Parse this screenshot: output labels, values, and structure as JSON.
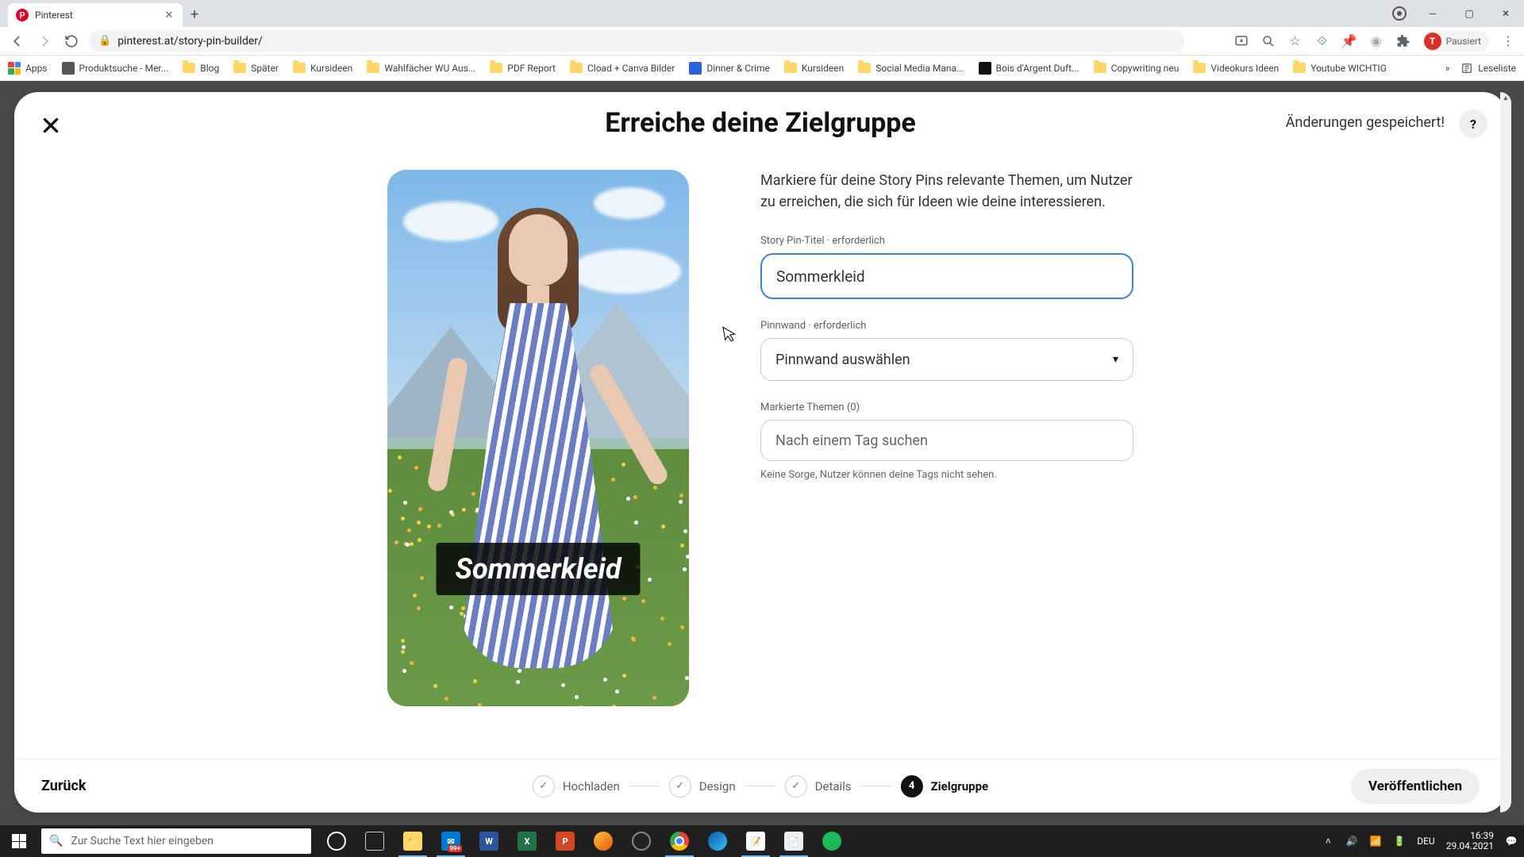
{
  "browser": {
    "tab_title": "Pinterest",
    "url": "pinterest.at/story-pin-builder/",
    "profile_state": "Pausiert",
    "profile_initial": "T"
  },
  "bookmarks": {
    "apps": "Apps",
    "items": [
      {
        "label": "Produktsuche - Mer...",
        "type": "page",
        "color": "#555"
      },
      {
        "label": "Blog",
        "type": "folder"
      },
      {
        "label": "Später",
        "type": "folder"
      },
      {
        "label": "Kursideen",
        "type": "folder"
      },
      {
        "label": "Wahlfächer WU Aus...",
        "type": "folder"
      },
      {
        "label": "PDF Report",
        "type": "folder"
      },
      {
        "label": "Cload + Canva Bilder",
        "type": "folder"
      },
      {
        "label": "Dinner & Crime",
        "type": "page",
        "color": "#2962d9"
      },
      {
        "label": "Kursideen",
        "type": "folder"
      },
      {
        "label": "Social Media Mana...",
        "type": "folder"
      },
      {
        "label": "Bois d'Argent Duft...",
        "type": "page",
        "color": "#111"
      },
      {
        "label": "Copywriting neu",
        "type": "folder"
      },
      {
        "label": "Videokurs Ideen",
        "type": "folder"
      },
      {
        "label": "Youtube WICHTIG",
        "type": "folder"
      }
    ],
    "reading_list": "Leseliste"
  },
  "modal": {
    "title": "Erreiche deine Zielgruppe",
    "saved": "Änderungen gespeichert!",
    "help": "?",
    "helper": "Markiere für deine Story Pins relevante Themen, um Nutzer zu erreichen, die sich für Ideen wie deine interessieren.",
    "preview_overlay": "Sommerkleid",
    "fields": {
      "title_label": "Story Pin-Titel · erforderlich",
      "title_value": "Sommerkleid",
      "board_label": "Pinnwand · erforderlich",
      "board_placeholder": "Pinnwand auswählen",
      "tags_label": "Markierte Themen (0)",
      "tags_placeholder": "Nach einem Tag suchen",
      "tags_hint": "Keine Sorge, Nutzer können deine Tags nicht sehen."
    }
  },
  "footer": {
    "back": "Zurück",
    "steps": [
      {
        "label": "Hochladen",
        "state": "done"
      },
      {
        "label": "Design",
        "state": "done"
      },
      {
        "label": "Details",
        "state": "done"
      },
      {
        "label": "Zielgruppe",
        "state": "active",
        "num": "4"
      }
    ],
    "publish": "Veröffentlichen"
  },
  "taskbar": {
    "search_placeholder": "Zur Suche Text hier eingeben",
    "lang": "DEU",
    "time": "16:39",
    "date": "29.04.2021",
    "badge": "99+"
  }
}
